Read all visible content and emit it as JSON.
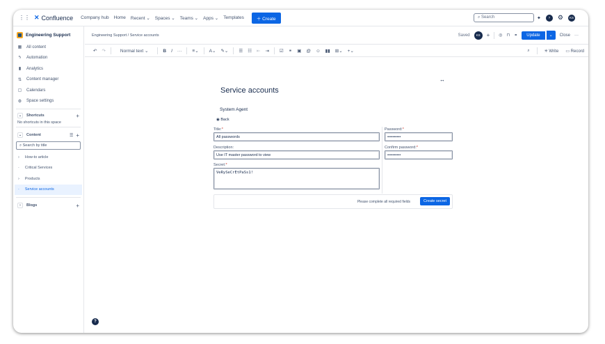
{
  "app": {
    "name": "Confluence"
  },
  "topnav": {
    "items": [
      "Company hub",
      "Home",
      "Recent ⌄",
      "Spaces ⌄",
      "Teams ⌄",
      "Apps ⌄",
      "Templates"
    ],
    "create": "Create",
    "search_placeholder": "Search",
    "avatar": "KS"
  },
  "sidebar": {
    "space": "Engineering Support",
    "items": [
      "All content",
      "Automation",
      "Analytics",
      "Content manager",
      "Calendars",
      "Space settings"
    ],
    "shortcuts": "Shortcuts",
    "no_shortcuts": "No shortcuts in this space",
    "content": "Content",
    "search_placeholder": "Search by title",
    "tree": [
      "How-to article",
      "Critical Services",
      "Products",
      "Service accounts"
    ],
    "blogs": "Blogs"
  },
  "header": {
    "breadcrumb": [
      "Engineering Support",
      "Service accounts"
    ],
    "saved": "Saved",
    "avatar": "KS",
    "update": "Update",
    "close": "Close"
  },
  "toolbar": {
    "text_style": "Normal text ⌄",
    "write": "Write",
    "record": "Record"
  },
  "page": {
    "title": "Service accounts",
    "agent": "System Agent",
    "back": "Back",
    "form": {
      "title_label": "Title:",
      "title_value": "All passwords",
      "desc_label": "Description:",
      "desc_value": "Use IT master password to view",
      "secret_label": "Secret:",
      "secret_value": "VeRySeCrEtPaSs1!",
      "password_label": "Password:",
      "password_value": "••••••••••",
      "confirm_label": "Confirm password:",
      "confirm_value": "••••••••••",
      "hint": "Please complete all required fields",
      "submit": "Create secret"
    }
  },
  "colors": {
    "accent": "#0c66e4"
  }
}
